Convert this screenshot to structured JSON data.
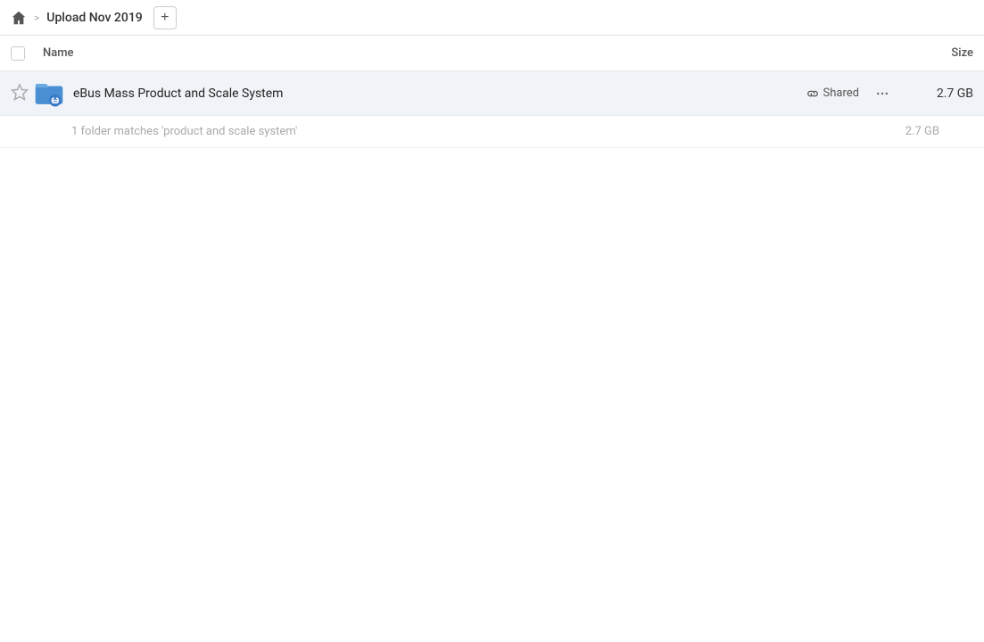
{
  "header": {
    "home_icon": "home-icon",
    "breadcrumb_separator": ">",
    "breadcrumb_text": "Upload Nov 2019",
    "add_button_label": "+"
  },
  "table": {
    "col_name_label": "Name",
    "col_size_label": "Size"
  },
  "file_row": {
    "name": "eBus Mass Product and Scale System",
    "shared_label": "Shared",
    "size": "2.7 GB",
    "more_icon": "more-options-icon",
    "star_icon": "star-icon",
    "link_icon": "link-icon"
  },
  "match_info": {
    "text": "1 folder matches 'product and scale system'",
    "size": "2.7 GB"
  }
}
